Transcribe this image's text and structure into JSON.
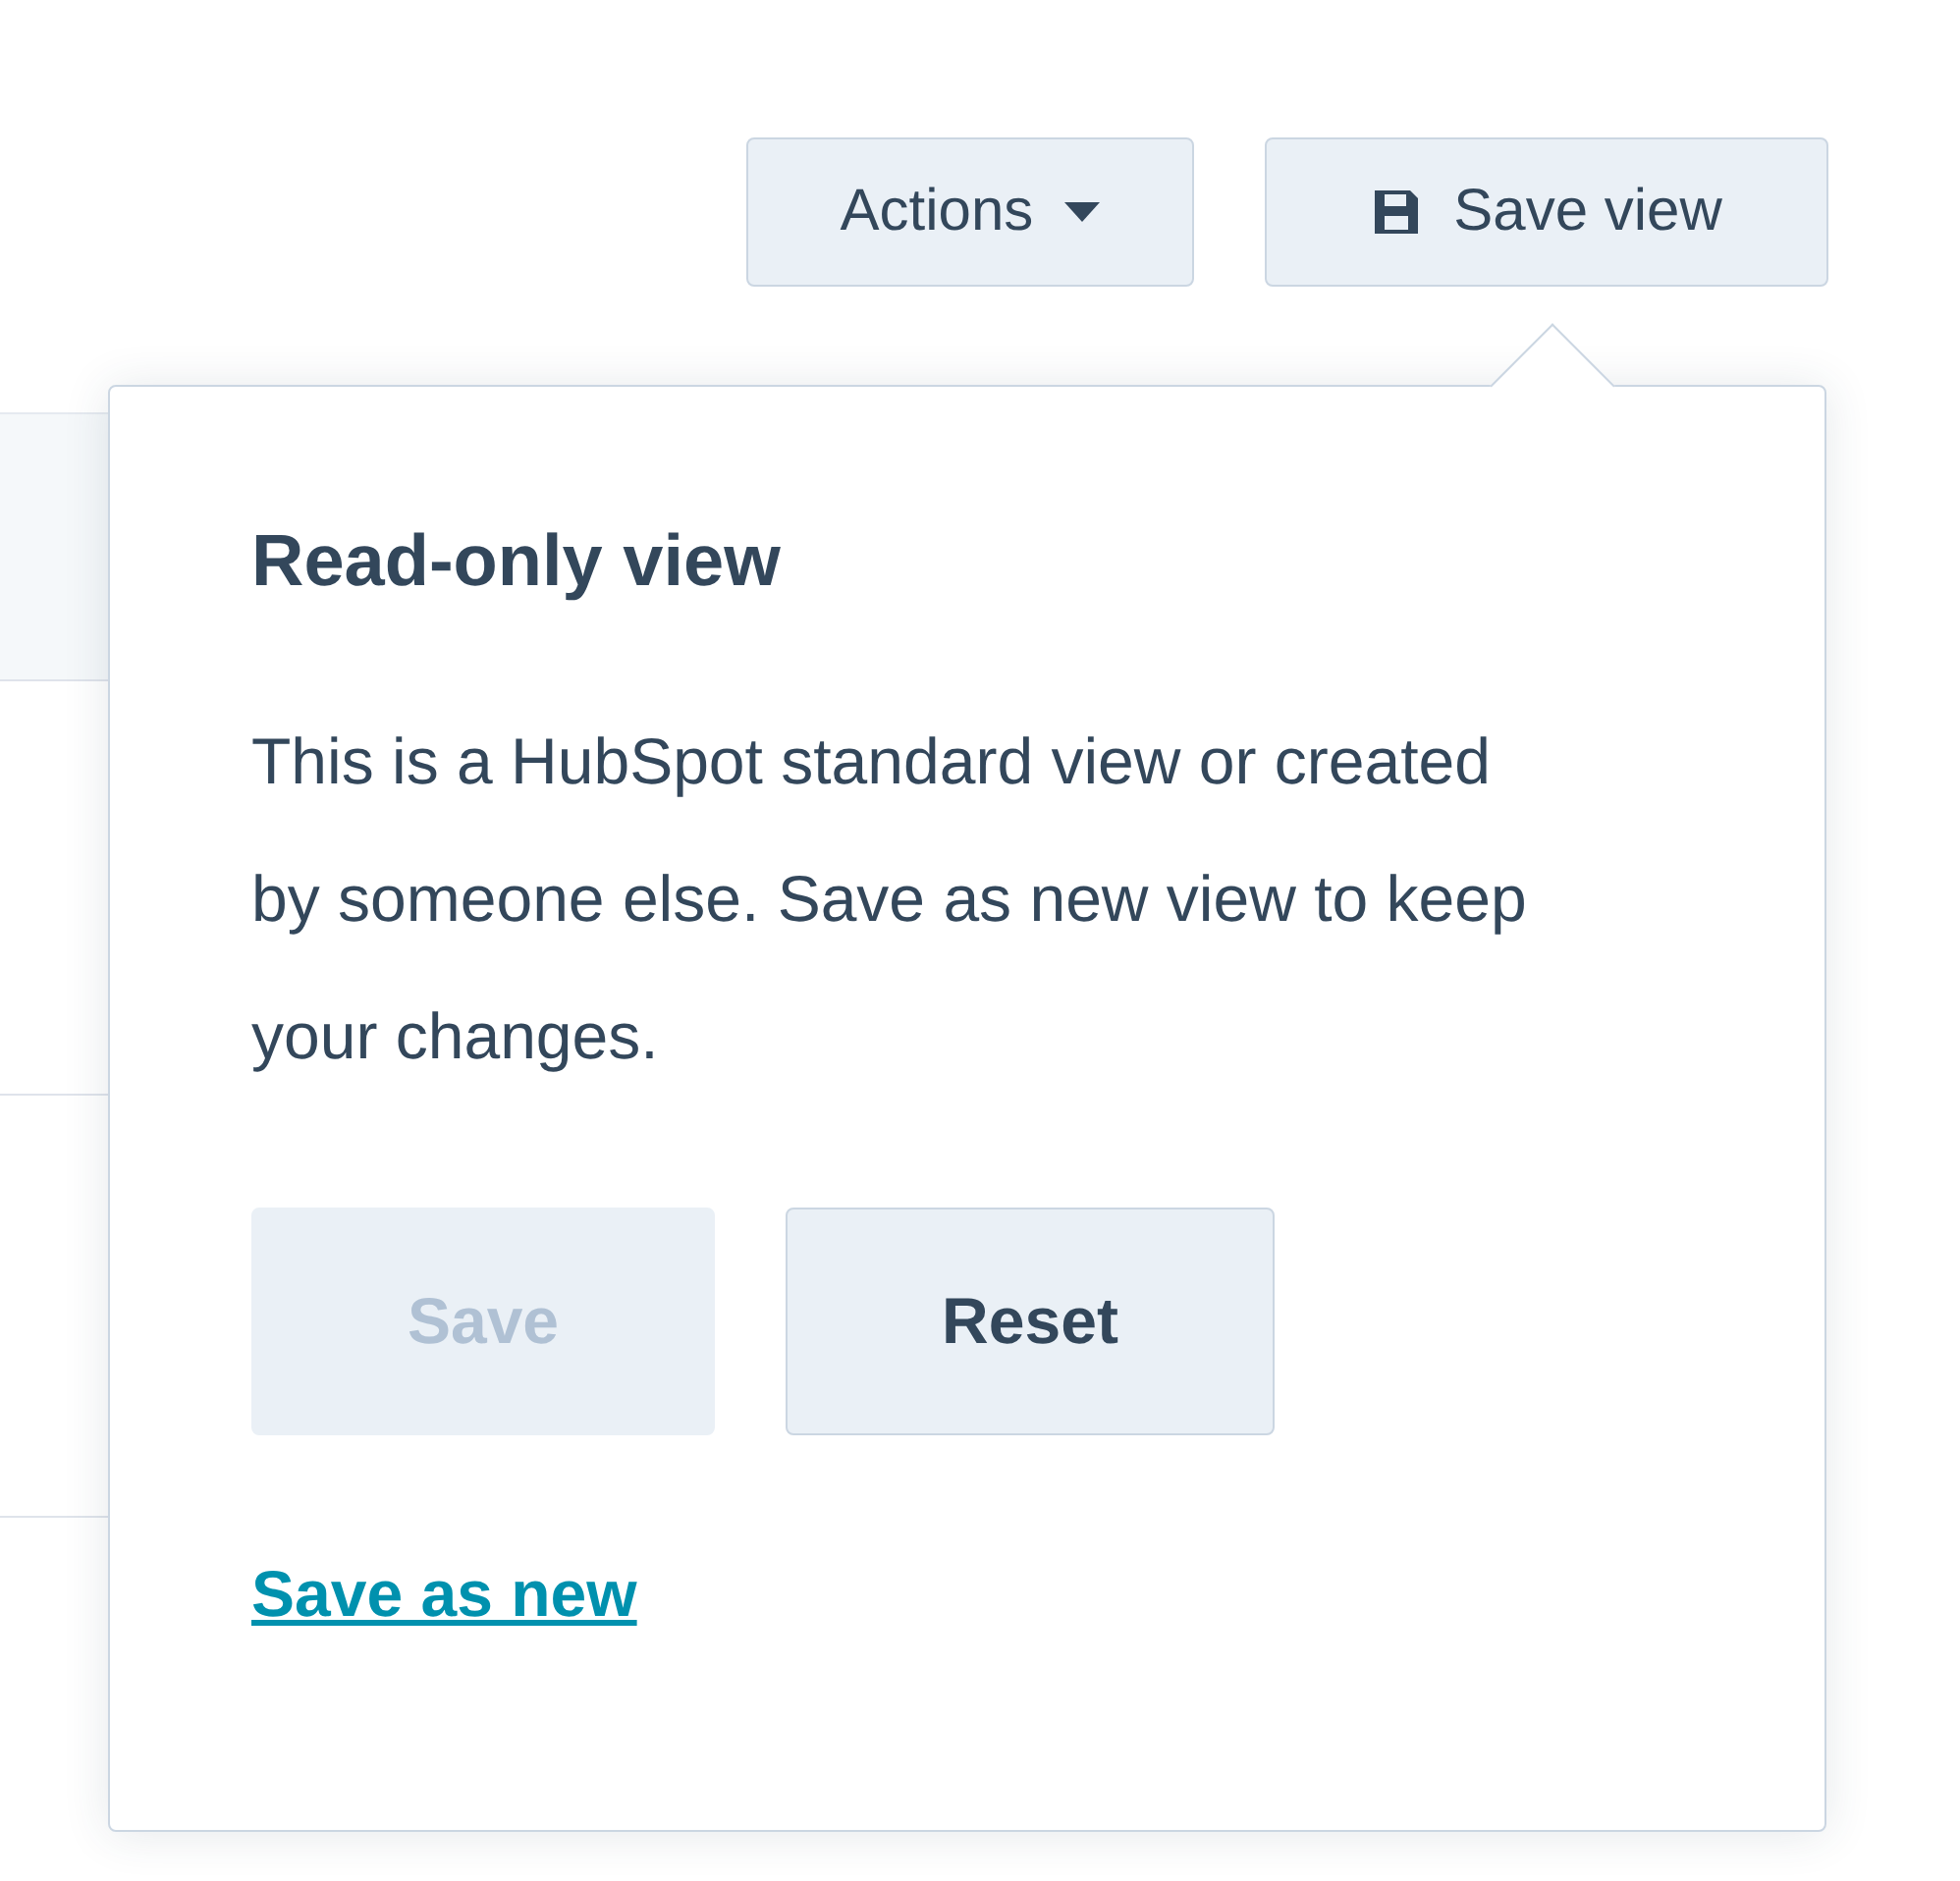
{
  "toolbar": {
    "buttons": [
      {
        "label": "Actions",
        "kind": "dropdown"
      },
      {
        "label": "Save view",
        "kind": "save"
      }
    ]
  },
  "popover": {
    "title": "Read-only view",
    "message": "This is a HubSpot standard view or created by someone else. Save as new view to keep your changes.",
    "buttons": [
      {
        "label": "Save",
        "disabled": true
      },
      {
        "label": "Reset",
        "disabled": false
      }
    ],
    "link": "Save as new"
  }
}
